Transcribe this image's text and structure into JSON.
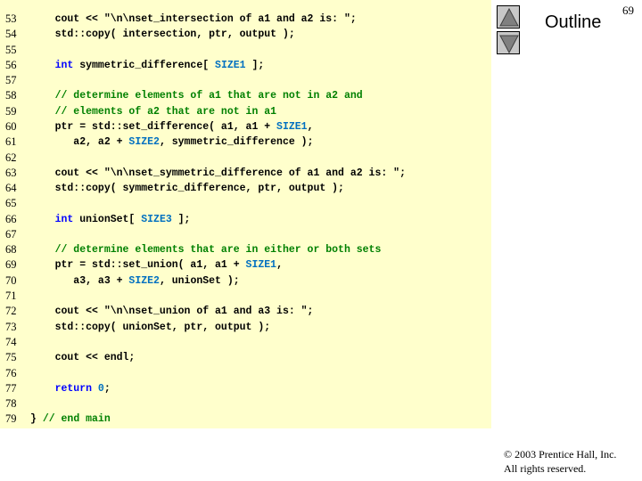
{
  "slide": {
    "page_number": "69",
    "outline_label": "Outline",
    "copyright_line1": "© 2003 Prentice Hall, Inc.",
    "copyright_line2": "All rights reserved.",
    "nav": {
      "up_icon": "triangle-up-icon",
      "down_icon": "triangle-down-icon"
    }
  },
  "colors": {
    "panel_background": "#ffffcc",
    "keyword": "#0000ff",
    "comment": "#008000",
    "number": "#0070c0"
  },
  "code": {
    "lines": [
      {
        "num": "53",
        "segments": [
          [
            "",
            "    cout << \"\\n\\nset_intersection of a1 and a2 is: \";"
          ]
        ]
      },
      {
        "num": "54",
        "segments": [
          [
            "",
            "    std::copy( intersection, ptr, output );"
          ]
        ]
      },
      {
        "num": "55",
        "segments": []
      },
      {
        "num": "56",
        "segments": [
          [
            "kw",
            "    int"
          ],
          [
            "",
            " symmetric_difference[ "
          ],
          [
            "num",
            "SIZE1"
          ],
          [
            "",
            " ];"
          ]
        ]
      },
      {
        "num": "57",
        "segments": []
      },
      {
        "num": "58",
        "segments": [
          [
            "cm",
            "    // determine elements of a1 that are not in a2 and"
          ]
        ]
      },
      {
        "num": "59",
        "segments": [
          [
            "cm",
            "    // elements of a2 that are not in a1"
          ]
        ]
      },
      {
        "num": "60",
        "segments": [
          [
            "",
            "    ptr = std::set_difference( a1, a1 + "
          ],
          [
            "num",
            "SIZE1"
          ],
          [
            "",
            ","
          ]
        ]
      },
      {
        "num": "61",
        "segments": [
          [
            "",
            "       a2, a2 + "
          ],
          [
            "num",
            "SIZE2"
          ],
          [
            "",
            ", symmetric_difference );"
          ]
        ]
      },
      {
        "num": "62",
        "segments": []
      },
      {
        "num": "63",
        "segments": [
          [
            "",
            "    cout << \"\\n\\nset_symmetric_difference of a1 and a2 is: \";"
          ]
        ]
      },
      {
        "num": "64",
        "segments": [
          [
            "",
            "    std::copy( symmetric_difference, ptr, output );"
          ]
        ]
      },
      {
        "num": "65",
        "segments": []
      },
      {
        "num": "66",
        "segments": [
          [
            "kw",
            "    int"
          ],
          [
            "",
            " unionSet[ "
          ],
          [
            "num",
            "SIZE3"
          ],
          [
            "",
            " ];"
          ]
        ]
      },
      {
        "num": "67",
        "segments": []
      },
      {
        "num": "68",
        "segments": [
          [
            "cm",
            "    // determine elements that are in either or both sets"
          ]
        ]
      },
      {
        "num": "69",
        "segments": [
          [
            "",
            "    ptr = std::set_union( a1, a1 + "
          ],
          [
            "num",
            "SIZE1"
          ],
          [
            "",
            ","
          ]
        ]
      },
      {
        "num": "70",
        "segments": [
          [
            "",
            "       a3, a3 + "
          ],
          [
            "num",
            "SIZE2"
          ],
          [
            "",
            ", unionSet );"
          ]
        ]
      },
      {
        "num": "71",
        "segments": []
      },
      {
        "num": "72",
        "segments": [
          [
            "",
            "    cout << \"\\n\\nset_union of a1 and a3 is: \";"
          ]
        ]
      },
      {
        "num": "73",
        "segments": [
          [
            "",
            "    std::copy( unionSet, ptr, output );"
          ]
        ]
      },
      {
        "num": "74",
        "segments": []
      },
      {
        "num": "75",
        "segments": [
          [
            "",
            "    cout << endl;"
          ]
        ]
      },
      {
        "num": "76",
        "segments": []
      },
      {
        "num": "77",
        "segments": [
          [
            "kw",
            "    return"
          ],
          [
            "",
            " "
          ],
          [
            "num",
            "0"
          ],
          [
            "",
            ";"
          ]
        ]
      },
      {
        "num": "78",
        "segments": []
      },
      {
        "num": "79",
        "segments": [
          [
            "",
            "} "
          ],
          [
            "cm",
            "// end main"
          ]
        ]
      }
    ]
  }
}
